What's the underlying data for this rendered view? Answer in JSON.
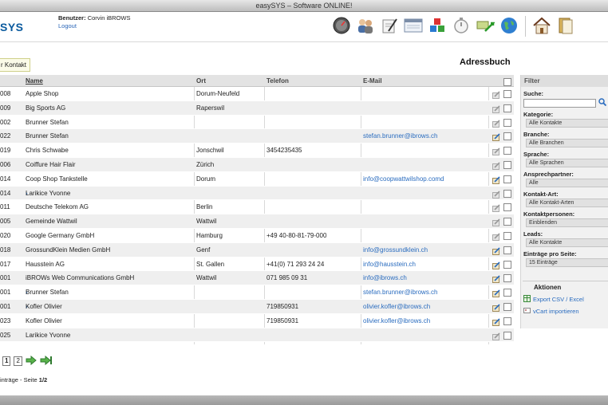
{
  "window": {
    "title": "easySYS – Software ONLINE!"
  },
  "brand": {
    "logo_text": "SYS"
  },
  "user": {
    "label": "Benutzer:",
    "name": "Corvin iBROWS",
    "logout": "Logout"
  },
  "toolbar_icons": [
    "dashboard-gauge-icon",
    "contacts-people-icon",
    "notes-pen-icon",
    "calendar-window-icon",
    "products-cubes-icon",
    "timer-stopwatch-icon",
    "money-transfer-icon",
    "globe-icon",
    "home-icon",
    "documents-icon"
  ],
  "page": {
    "title": "Adressbuch",
    "new_contact_button": "r Kontakt"
  },
  "table": {
    "columns": {
      "id": "",
      "name": "Name",
      "ort": "Ort",
      "telefon": "Telefon",
      "email": "E-Mail"
    },
    "rows": [
      {
        "id": "008",
        "name": "Apple Shop",
        "ort": "Dorum-Neufeld",
        "telefon": "",
        "email": "",
        "sub": false
      },
      {
        "id": "009",
        "name": "Big Sports AG",
        "ort": "Raperswil",
        "telefon": "",
        "email": "",
        "sub": false
      },
      {
        "id": "002",
        "name": "Brunner Stefan",
        "ort": "",
        "telefon": "",
        "email": "",
        "sub": false
      },
      {
        "id": "022",
        "name": "Brunner Stefan",
        "ort": "",
        "telefon": "",
        "email": "stefan.brunner@ibrows.ch",
        "sub": false
      },
      {
        "id": "019",
        "name": "Chris Schwabe",
        "ort": "Jonschwil",
        "telefon": "3454235435",
        "email": "",
        "sub": false
      },
      {
        "id": "006",
        "name": "Coiffure Hair Flair",
        "ort": "Zürich",
        "telefon": "",
        "email": "",
        "sub": false
      },
      {
        "id": "014",
        "name": "Coop Shop Tankstelle",
        "ort": "Dorum",
        "telefon": "",
        "email": "info@coopwattwilshop.comd",
        "sub": false
      },
      {
        "id": "014",
        "name": "Larikice Yvonne",
        "ort": "",
        "telefon": "",
        "email": "",
        "sub": true
      },
      {
        "id": "011",
        "name": "Deutsche Telekom AG",
        "ort": "Berlin",
        "telefon": "",
        "email": "",
        "sub": false
      },
      {
        "id": "005",
        "name": "Gemeinde Wattwil",
        "ort": "Wattwil",
        "telefon": "",
        "email": "",
        "sub": false
      },
      {
        "id": "020",
        "name": "Google Germany GmbH",
        "ort": "Hamburg",
        "telefon": "+49 40-80-81-79-000",
        "email": "",
        "sub": false
      },
      {
        "id": "018",
        "name": "GrossundKlein Medien GmbH",
        "ort": "Genf",
        "telefon": "",
        "email": "info@grossundklein.ch",
        "sub": false
      },
      {
        "id": "017",
        "name": "Hausstein AG",
        "ort": "St. Gallen",
        "telefon": "+41(0) 71 293 24 24",
        "email": "info@hausstein.ch",
        "sub": false
      },
      {
        "id": "001",
        "name": "iBROWs Web Communications GmbH",
        "ort": "Wattwil",
        "telefon": "071 985 09 31",
        "email": "info@ibrows.ch",
        "sub": false
      },
      {
        "id": "001",
        "name": "Brunner Stefan",
        "ort": "",
        "telefon": "",
        "email": "stefan.brunner@ibrows.ch",
        "sub": true
      },
      {
        "id": "001",
        "name": "Kofler Olivier",
        "ort": "",
        "telefon": "719850931",
        "email": "olivier.kofler@ibrows.ch",
        "sub": true
      },
      {
        "id": "023",
        "name": "Kofler Olivier",
        "ort": "",
        "telefon": "719850931",
        "email": "olivier.kofler@ibrows.ch",
        "sub": false
      },
      {
        "id": "025",
        "name": "Larikice Yvonne",
        "ort": "",
        "telefon": "",
        "email": "",
        "sub": false
      }
    ]
  },
  "pagination": {
    "pages": [
      "1",
      "2"
    ],
    "current": "1",
    "summary_prefix": "inträge - Seite ",
    "summary_page": "1/2"
  },
  "filter": {
    "title": "Filter",
    "search_label": "Suche:",
    "fields": [
      {
        "label": "Kategorie:",
        "value": "Alle Kontakte"
      },
      {
        "label": "Branche:",
        "value": "Alle Branchen"
      },
      {
        "label": "Sprache:",
        "value": "Alle Sprachen"
      },
      {
        "label": "Ansprechpartner:",
        "value": "Alle"
      },
      {
        "label": "Kontakt-Art:",
        "value": "Alle Kontakt-Arten"
      },
      {
        "label": "Kontaktpersonen:",
        "value": "Einblenden"
      },
      {
        "label": "Leads:",
        "value": "Alle Kontakte"
      },
      {
        "label": "Einträge pro Seite:",
        "value": "15 Einträge"
      }
    ]
  },
  "actions": {
    "title": "Aktionen",
    "export": "Export CSV / Excel",
    "import": "vCart importieren"
  }
}
